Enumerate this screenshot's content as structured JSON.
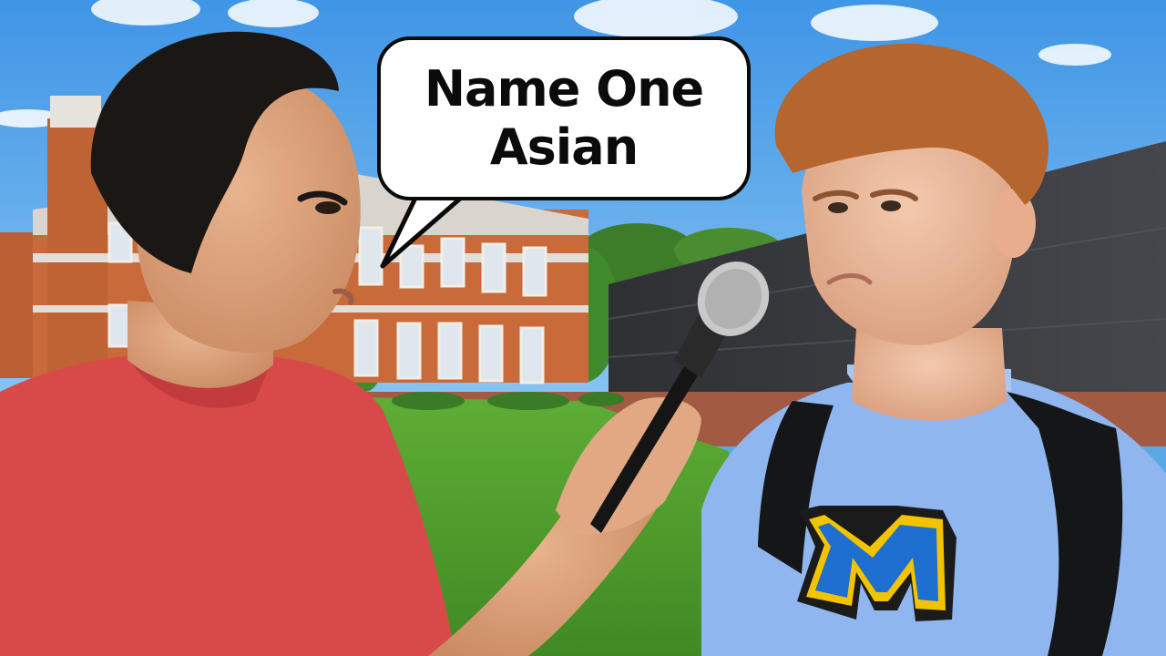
{
  "thumbnail": {
    "speech_bubble": {
      "line1": "Name One",
      "line2": "Asian"
    },
    "sweatshirt_logo": "M"
  },
  "colors": {
    "sky": "#5aa8e8",
    "brick": "#c96a3a",
    "grass": "#4e9a2e",
    "red_shirt": "#d84a4a",
    "blue_sweatshirt": "#8fb6ef",
    "logo_blue": "#1f6fd0",
    "logo_gold": "#f2c400",
    "dark_wall": "#3a3c40",
    "bubble_fill": "#ffffff",
    "bubble_outline": "#0a0a0a"
  }
}
